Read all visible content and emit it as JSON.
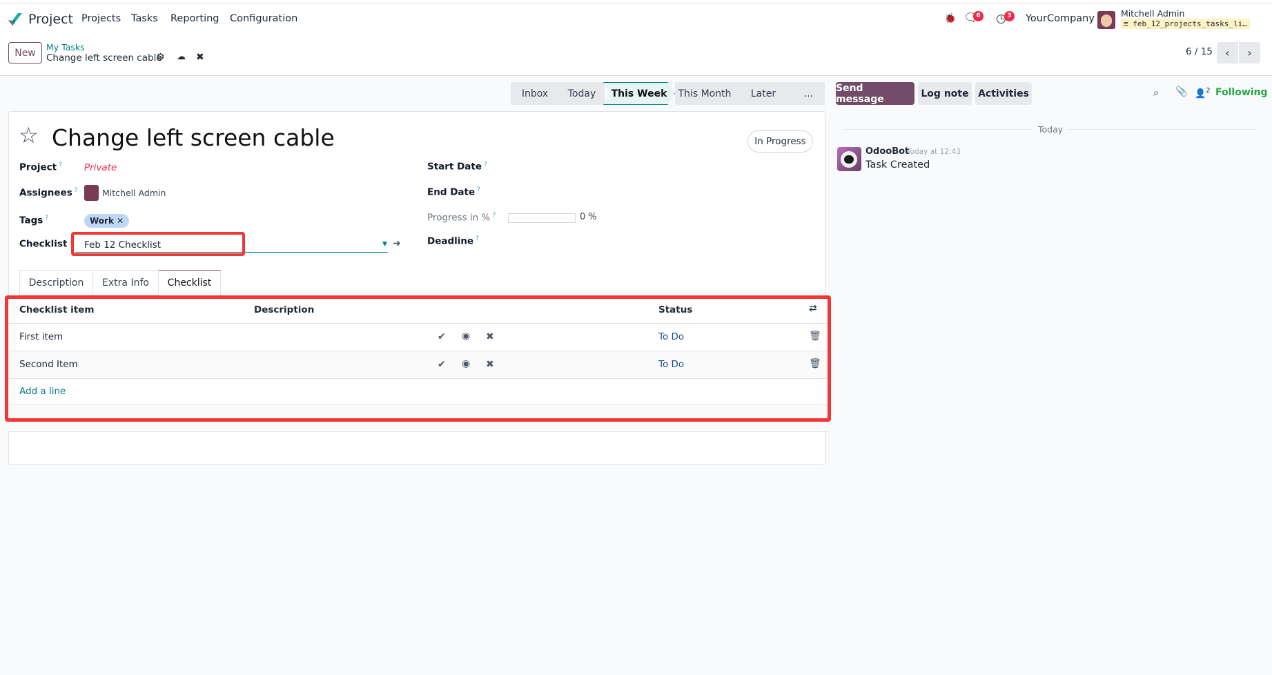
{
  "app": {
    "name": "Project",
    "menu": [
      "Projects",
      "Tasks",
      "Reporting",
      "Configuration"
    ]
  },
  "systray": {
    "chat_count": "6",
    "activity_count": "3",
    "company": "YourCompany",
    "user": "Mitchell Admin",
    "database": "feb_12_projects_tasks_li…"
  },
  "control": {
    "new_label": "New",
    "breadcrumb_parent": "My Tasks",
    "breadcrumb_current": "Change left screen cable",
    "pager": "6 / 15"
  },
  "stages": [
    "Inbox",
    "Today",
    "This Week",
    "This Month",
    "Later",
    "..."
  ],
  "active_stage": "This Week",
  "chatter": {
    "send_message": "Send message",
    "log_note": "Log note",
    "activities": "Activities",
    "followers_count": "2",
    "following": "Following",
    "date_separator": "Today",
    "messages": [
      {
        "author": "OdooBot",
        "time": "Today at 12:43",
        "body": "Task Created"
      }
    ]
  },
  "form": {
    "title": "Change left screen cable",
    "state": "In Progress",
    "project_label": "Project",
    "project_value": "Private",
    "assignees_label": "Assignees",
    "assignee": "Mitchell Admin",
    "tags_label": "Tags",
    "tag": "Work",
    "checklist_label": "Checklist",
    "checklist_value": "Feb 12 Checklist",
    "start_date_label": "Start Date",
    "end_date_label": "End Date",
    "progress_label": "Progress in %",
    "progress_value": "0 %",
    "progress": 0,
    "deadline_label": "Deadline",
    "help_mark": "?",
    "tabs": [
      "Description",
      "Extra Info",
      "Checklist"
    ],
    "active_tab": "Checklist"
  },
  "table": {
    "headers": [
      "Checklist item",
      "Description",
      "Status"
    ],
    "rows": [
      {
        "item": "First item",
        "description": "",
        "status": "To Do"
      },
      {
        "item": "Second Item",
        "description": "",
        "status": "To Do"
      }
    ],
    "add_line": "Add a line"
  },
  "colors": {
    "primary": "#714b67",
    "link": "#017e84",
    "highlight": "#f53434",
    "danger": "#f0284a",
    "following": "#28a745"
  }
}
